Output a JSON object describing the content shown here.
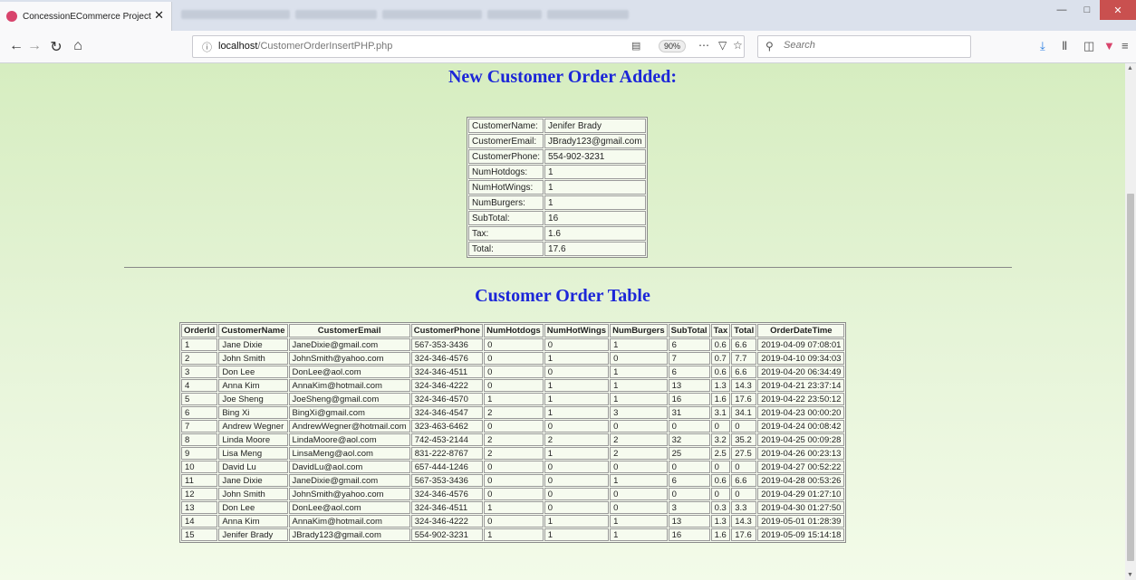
{
  "browser": {
    "tab_title": "ConcessionECommerce Project",
    "tab_close": "✕",
    "url_host": "localhost",
    "url_path": "/CustomerOrderInsertPHP.php",
    "zoom": "90%",
    "search_placeholder": "Search"
  },
  "page": {
    "heading_added": "New Customer Order Added:",
    "heading_table": "Customer Order Table"
  },
  "added_order": [
    {
      "label": "CustomerName:",
      "value": "Jenifer Brady"
    },
    {
      "label": "CustomerEmail:",
      "value": "JBrady123@gmail.com"
    },
    {
      "label": "CustomerPhone:",
      "value": "554-902-3231"
    },
    {
      "label": "NumHotdogs:",
      "value": "1"
    },
    {
      "label": "NumHotWings:",
      "value": "1"
    },
    {
      "label": "NumBurgers:",
      "value": "1"
    },
    {
      "label": "SubTotal:",
      "value": "16"
    },
    {
      "label": "Tax:",
      "value": "1.6"
    },
    {
      "label": "Total:",
      "value": "17.6"
    }
  ],
  "orders": {
    "headers": [
      "OrderId",
      "CustomerName",
      "CustomerEmail",
      "CustomerPhone",
      "NumHotdogs",
      "NumHotWings",
      "NumBurgers",
      "SubTotal",
      "Tax",
      "Total",
      "OrderDateTime"
    ],
    "rows": [
      [
        "1",
        "Jane Dixie",
        "JaneDixie@gmail.com",
        "567-353-3436",
        "0",
        "0",
        "1",
        "6",
        "0.6",
        "6.6",
        "2019-04-09 07:08:01"
      ],
      [
        "2",
        "John Smith",
        "JohnSmith@yahoo.com",
        "324-346-4576",
        "0",
        "1",
        "0",
        "7",
        "0.7",
        "7.7",
        "2019-04-10 09:34:03"
      ],
      [
        "3",
        "Don Lee",
        "DonLee@aol.com",
        "324-346-4511",
        "0",
        "0",
        "1",
        "6",
        "0.6",
        "6.6",
        "2019-04-20 06:34:49"
      ],
      [
        "4",
        "Anna Kim",
        "AnnaKim@hotmail.com",
        "324-346-4222",
        "0",
        "1",
        "1",
        "13",
        "1.3",
        "14.3",
        "2019-04-21 23:37:14"
      ],
      [
        "5",
        "Joe Sheng",
        "JoeSheng@gmail.com",
        "324-346-4570",
        "1",
        "1",
        "1",
        "16",
        "1.6",
        "17.6",
        "2019-04-22 23:50:12"
      ],
      [
        "6",
        "Bing Xi",
        "BingXi@gmail.com",
        "324-346-4547",
        "2",
        "1",
        "3",
        "31",
        "3.1",
        "34.1",
        "2019-04-23 00:00:20"
      ],
      [
        "7",
        "Andrew Wegner",
        "AndrewWegner@hotmail.com",
        "323-463-6462",
        "0",
        "0",
        "0",
        "0",
        "0",
        "0",
        "2019-04-24 00:08:42"
      ],
      [
        "8",
        "Linda Moore",
        "LindaMoore@aol.com",
        "742-453-2144",
        "2",
        "2",
        "2",
        "32",
        "3.2",
        "35.2",
        "2019-04-25 00:09:28"
      ],
      [
        "9",
        "Lisa Meng",
        "LinsaMeng@aol.com",
        "831-222-8767",
        "2",
        "1",
        "2",
        "25",
        "2.5",
        "27.5",
        "2019-04-26 00:23:13"
      ],
      [
        "10",
        "David Lu",
        "DavidLu@aol.com",
        "657-444-1246",
        "0",
        "0",
        "0",
        "0",
        "0",
        "0",
        "2019-04-27 00:52:22"
      ],
      [
        "11",
        "Jane Dixie",
        "JaneDixie@gmail.com",
        "567-353-3436",
        "0",
        "0",
        "1",
        "6",
        "0.6",
        "6.6",
        "2019-04-28 00:53:26"
      ],
      [
        "12",
        "John Smith",
        "JohnSmith@yahoo.com",
        "324-346-4576",
        "0",
        "0",
        "0",
        "0",
        "0",
        "0",
        "2019-04-29 01:27:10"
      ],
      [
        "13",
        "Don Lee",
        "DonLee@aol.com",
        "324-346-4511",
        "1",
        "0",
        "0",
        "3",
        "0.3",
        "3.3",
        "2019-04-30 01:27:50"
      ],
      [
        "14",
        "Anna Kim",
        "AnnaKim@hotmail.com",
        "324-346-4222",
        "0",
        "1",
        "1",
        "13",
        "1.3",
        "14.3",
        "2019-05-01 01:28:39"
      ],
      [
        "15",
        "Jenifer Brady",
        "JBrady123@gmail.com",
        "554-902-3231",
        "1",
        "1",
        "1",
        "16",
        "1.6",
        "17.6",
        "2019-05-09 15:14:18"
      ]
    ]
  }
}
